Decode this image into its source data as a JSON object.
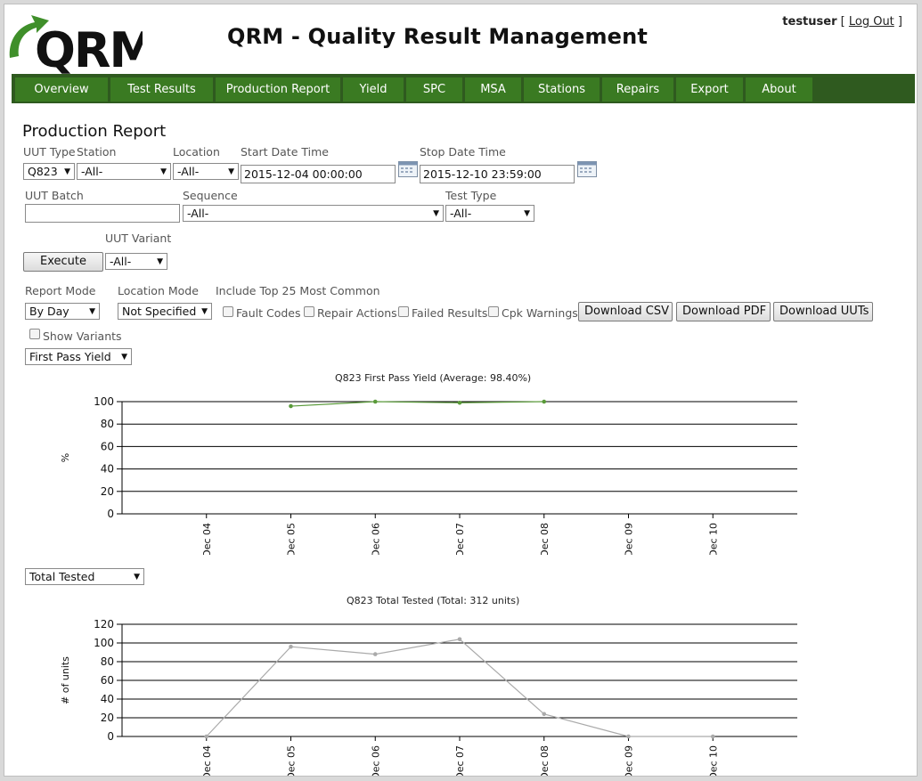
{
  "header": {
    "app_title": "QRM - Quality Result Management",
    "logo_text": "QRM",
    "user": {
      "name": "testuser",
      "logout_prefix": "[",
      "logout": "Log Out",
      "logout_suffix": "]"
    }
  },
  "nav": [
    "Overview",
    "Test Results",
    "Production Report",
    "Yield",
    "SPC",
    "MSA",
    "Stations",
    "Repairs",
    "Export",
    "About"
  ],
  "form": {
    "page_title": "Production Report",
    "uut_type": {
      "label": "UUT Type",
      "value": "Q823"
    },
    "station": {
      "label": "Station",
      "value": "-All-"
    },
    "location": {
      "label": "Location",
      "value": "-All-"
    },
    "start_dt": {
      "label": "Start Date Time",
      "value": "2015-12-04 00:00:00"
    },
    "stop_dt": {
      "label": "Stop Date Time",
      "value": "2015-12-10 23:59:00"
    },
    "uut_batch": {
      "label": "UUT Batch",
      "value": ""
    },
    "sequence": {
      "label": "Sequence",
      "value": "-All-"
    },
    "test_type": {
      "label": "Test Type",
      "value": "-All-"
    },
    "uut_variant": {
      "label": "UUT Variant",
      "value": "-All-"
    },
    "execute": "Execute",
    "report_mode": {
      "label": "Report Mode",
      "value": "By Day"
    },
    "location_mode": {
      "label": "Location Mode",
      "value": "Not Specified"
    },
    "include_top": "Include Top 25 Most Common",
    "checks": {
      "fault_codes": "Fault Codes",
      "repair_actions": "Repair Actions",
      "failed_results": "Failed Results",
      "cpk_warnings": "Cpk Warnings",
      "show_variants": "Show Variants"
    },
    "downloads": {
      "csv": "Download CSV",
      "pdf": "Download PDF",
      "uuts": "Download UUTs"
    }
  },
  "chart1_select": "First Pass Yield",
  "chart2_select": "Total Tested",
  "chart_data": [
    {
      "type": "line",
      "title": "Q823 First Pass Yield (Average: 98.40%)",
      "ylabel": "%",
      "xlabel": "",
      "categories": [
        "Dec 04",
        "Dec 05",
        "Dec 06",
        "Dec 07",
        "Dec 08",
        "Dec 09",
        "Dec 10"
      ],
      "values": [
        null,
        96,
        100,
        99,
        100,
        null,
        null
      ],
      "yticks": [
        0,
        20,
        40,
        60,
        80,
        100
      ],
      "ylim": [
        0,
        100
      ],
      "color": "#5a9a3a",
      "grid": true
    },
    {
      "type": "line",
      "title": "Q823 Total Tested (Total: 312 units)",
      "ylabel": "# of units",
      "xlabel": "",
      "categories": [
        "Dec 04",
        "Dec 05",
        "Dec 06",
        "Dec 07",
        "Dec 08",
        "Dec 09",
        "Dec 10"
      ],
      "values": [
        0,
        96,
        88,
        104,
        24,
        0,
        0
      ],
      "yticks": [
        0,
        20,
        40,
        60,
        80,
        100,
        120
      ],
      "ylim": [
        0,
        120
      ],
      "color": "#aaaaaa",
      "grid": true
    }
  ]
}
